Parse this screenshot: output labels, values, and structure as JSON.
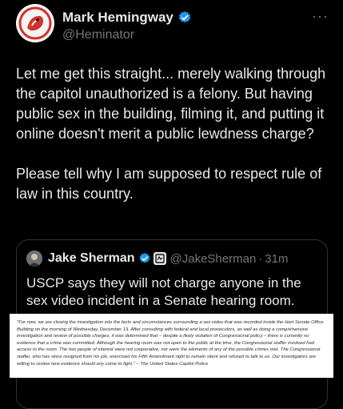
{
  "author": {
    "display_name": "Mark Hemingway",
    "handle": "@Heminator",
    "more_label": "···"
  },
  "tweet": {
    "text": "Let me get this straight... merely walking through the capitol unauthorized is a felony. But having public sex in the building, filming it, and putting it online doesn't merit a public lewdness charge?\n\nPlease tell why I am supposed to respect rule of law in this country."
  },
  "quoted": {
    "display_name": "Jake Sherman",
    "handle": "@JakeSherman",
    "separator": "·",
    "time": "31m",
    "text": "USCP says they will not charge anyone in the sex video incident in a Senate hearing room.",
    "statement": "\"For now, we are closing the investigation into the facts and circumstances surrounding a sex video that was recorded inside the Hart Senate Office Building on the morning of Wednesday, December 13. After consulting with federal and local prosecutors, as well as doing a comprehensive investigation and review of possible charges, it was determined that – despite a likely violation of Congressional policy – there is currently no evidence that a crime was committed. Although the hearing room was not open to the public at the time, the Congressional staffer involved had access to the room. The two people of interest were not cooperative, nor were the elements of any of the possible crimes met. The Congressional staffer, who has since resigned from his job, exercised his Fifth Amendment right to remain silent and refused to talk to us. Our investigators are willing to review new evidence should any come to light.\" – The United States Capitol Police"
  },
  "colors": {
    "background": "#000000",
    "text": "#e7e9ea",
    "secondary": "#71767b",
    "verified": "#1d9bf0",
    "border": "#2f3336"
  }
}
